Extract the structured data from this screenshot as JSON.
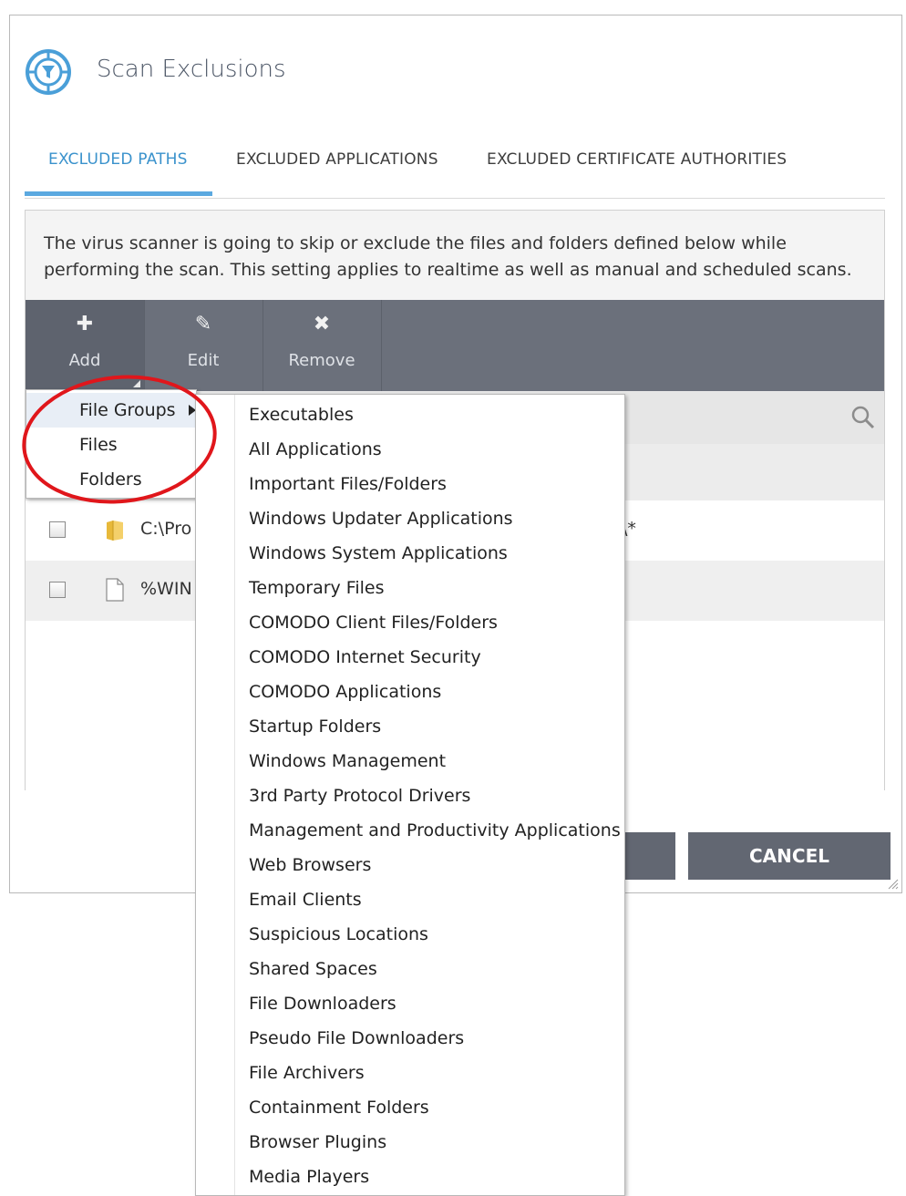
{
  "dialog": {
    "title": "Scan Exclusions",
    "tabs": [
      {
        "label": "EXCLUDED PATHS"
      },
      {
        "label": "EXCLUDED APPLICATIONS"
      },
      {
        "label": "EXCLUDED CERTIFICATE AUTHORITIES"
      }
    ],
    "description": "The virus scanner is going to skip or exclude the files and folders defined below while performing the scan. This setting applies to realtime as well as manual and scheduled scans.",
    "toolbar": {
      "add": "Add",
      "edit": "Edit",
      "remove": "Remove"
    },
    "rows": [
      {
        "path": "C:\\Pro",
        "tail": "\\*",
        "icon": "folder-icon"
      },
      {
        "path": "%WIN",
        "icon": "file-icon"
      }
    ],
    "buttons": {
      "cancel": "CANCEL"
    }
  },
  "add_menu": {
    "items": [
      "File Groups",
      "Files",
      "Folders"
    ]
  },
  "file_groups": [
    "Executables",
    "All Applications",
    "Important Files/Folders",
    "Windows Updater Applications",
    "Windows System Applications",
    "Temporary Files",
    "COMODO Client Files/Folders",
    "COMODO Internet Security",
    "COMODO Applications",
    "Startup Folders",
    "Windows Management",
    "3rd Party Protocol Drivers",
    "Management and Productivity Applications",
    "Web Browsers",
    "Email Clients",
    "Suspicious Locations",
    "Shared Spaces",
    "File Downloaders",
    "Pseudo File Downloaders",
    "File Archivers",
    "Containment Folders",
    "Browser Plugins",
    "Media Players"
  ],
  "colors": {
    "accent": "#3a92cc",
    "toolbar": "#6b707b",
    "button": "#626772",
    "annotation": "#e0161b"
  }
}
